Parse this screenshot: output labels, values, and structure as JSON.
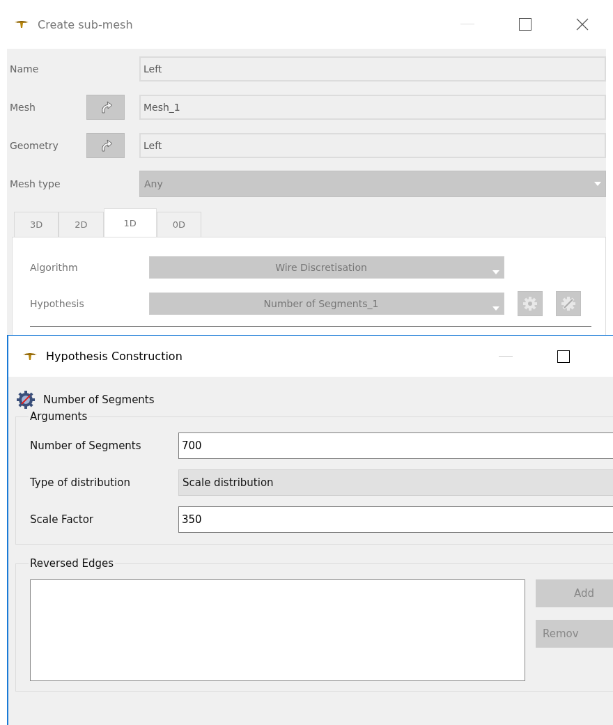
{
  "create_dialog": {
    "title": "Create sub-mesh",
    "active": false,
    "fields": [
      {
        "label": "Name",
        "value": "Left",
        "kind": "text"
      },
      {
        "label": "Mesh",
        "value": "Mesh_1",
        "kind": "select"
      },
      {
        "label": "Geometry",
        "value": "Left",
        "kind": "select"
      },
      {
        "label": "Mesh type",
        "value": "Any",
        "kind": "combo"
      }
    ],
    "tabs": [
      {
        "label": "3D",
        "selected": false
      },
      {
        "label": "2D",
        "selected": false
      },
      {
        "label": "1D",
        "selected": true
      },
      {
        "label": "0D",
        "selected": false
      }
    ],
    "algorithm": {
      "label": "Algorithm",
      "value": "Wire Discretisation"
    },
    "hypothesis": {
      "label": "Hypothesis",
      "value": "Number of Segments_1"
    }
  },
  "hypothesis_dialog": {
    "title": "Hypothesis Construction",
    "active": true,
    "heading": "Number of Segments",
    "arguments": {
      "title": "Arguments",
      "rows": [
        {
          "label": "Number of Segments",
          "value": "700",
          "kind": "input"
        },
        {
          "label": "Type of distribution",
          "value": "Scale distribution",
          "kind": "combo"
        },
        {
          "label": "Scale Factor",
          "value": "350",
          "kind": "input"
        }
      ]
    },
    "reversed_edges": {
      "title": "Reversed Edges",
      "buttons": [
        {
          "label": "Add",
          "disabled": true
        },
        {
          "label": "Remov",
          "disabled": true
        }
      ]
    }
  }
}
